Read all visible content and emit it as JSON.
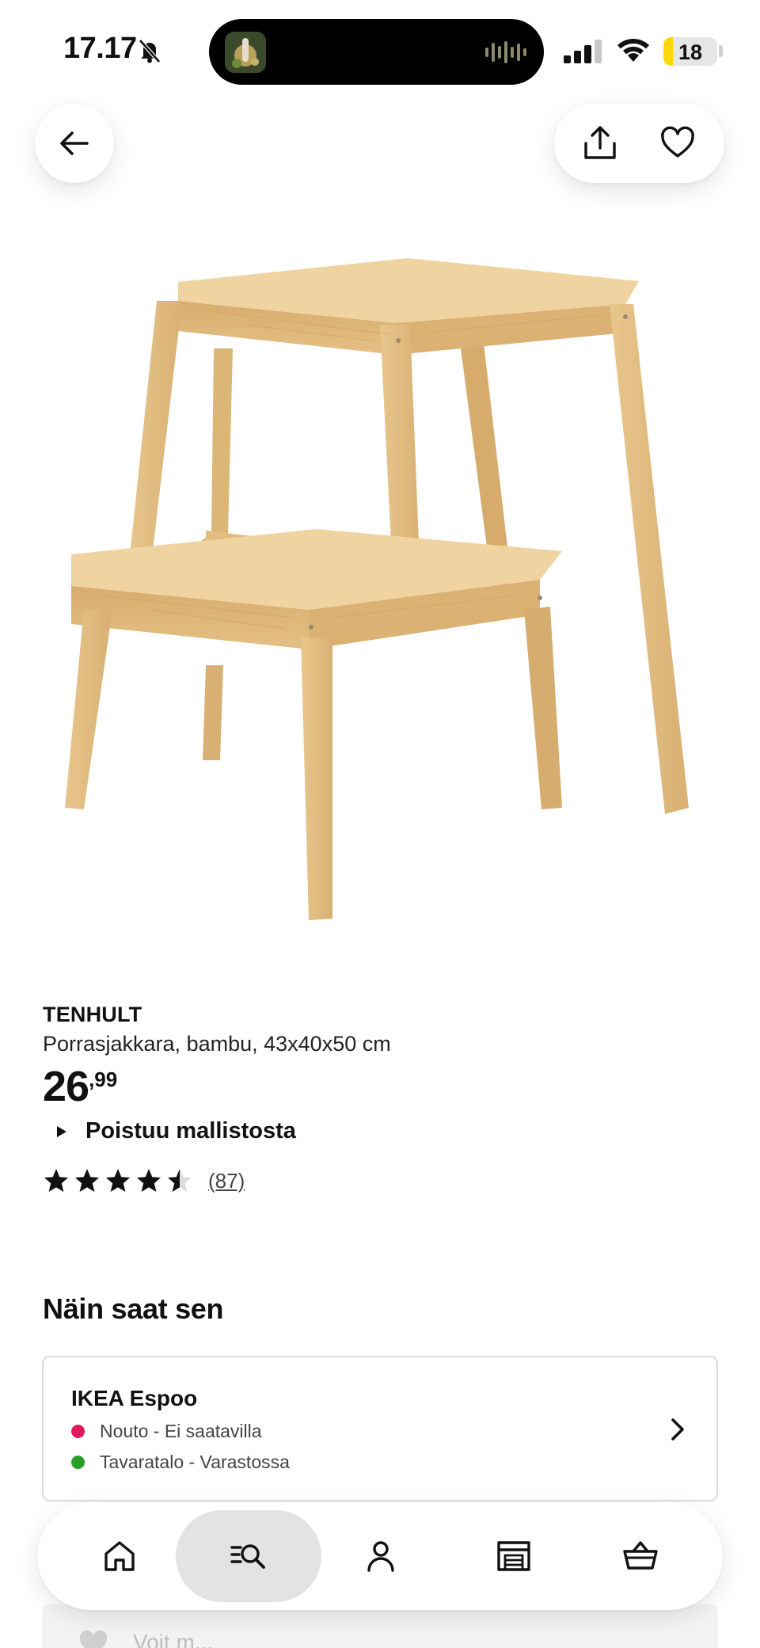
{
  "status_bar": {
    "time": "17.17",
    "battery": "18",
    "battery_level": 0.18,
    "icons": [
      "bell-slash-icon",
      "cellular-signal-icon",
      "wifi-icon",
      "battery-icon"
    ]
  },
  "header": {
    "back_icon": "arrow-left-icon",
    "share_icon": "share-icon",
    "favorite_icon": "heart-icon"
  },
  "product": {
    "name": "TENHULT",
    "description": "Porrasjakkara, bambu, 43x40x50 cm",
    "price_int": "26",
    "price_dec": ",99",
    "discontinued_label": "Poistuu mallistosta",
    "rating_value": 4.5,
    "rating_max": 5,
    "review_count": "(87)"
  },
  "delivery": {
    "title": "Näin saat sen",
    "store": "IKEA Espoo",
    "availability": [
      {
        "label": "Nouto - Ei saatavilla",
        "color": "#e0185c"
      },
      {
        "label": "Tavaratalo - Varastossa",
        "color": "#27a02a"
      }
    ]
  },
  "next_card": {
    "text": "Voit m..."
  },
  "nav": {
    "items": [
      {
        "name": "home",
        "icon": "home-icon",
        "active": false
      },
      {
        "name": "search",
        "icon": "search-list-icon",
        "active": true
      },
      {
        "name": "profile",
        "icon": "person-icon",
        "active": false
      },
      {
        "name": "store",
        "icon": "store-icon",
        "active": false
      },
      {
        "name": "cart",
        "icon": "basket-icon",
        "active": false
      }
    ]
  },
  "colors": {
    "accent_text": "#111111",
    "bamboo": "#e9c98f",
    "active_nav": "#e3e3e3"
  }
}
